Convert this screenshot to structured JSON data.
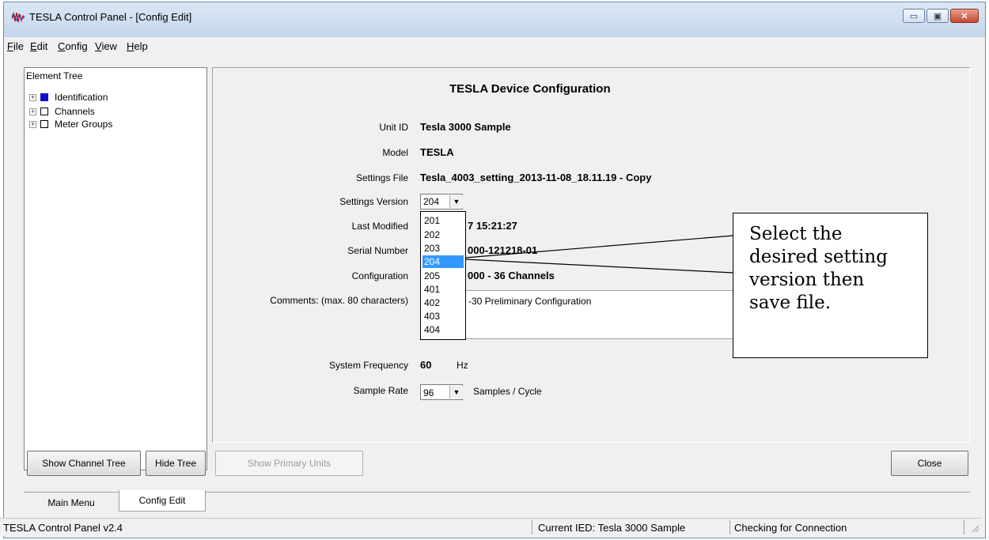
{
  "window": {
    "title": "TESLA Control Panel - [Config Edit]",
    "app_icon": "tesla-waveform-icon",
    "controls": {
      "minimize": "▭",
      "maximize": "▣",
      "close": "✕"
    }
  },
  "menu": [
    "File",
    "Edit",
    "Config",
    "View",
    "Help"
  ],
  "tree": {
    "header": "Element Tree",
    "items": [
      {
        "label": "Identification",
        "checked": true
      },
      {
        "label": "Channels",
        "checked": false
      },
      {
        "label": "Meter Groups",
        "checked": false
      }
    ]
  },
  "config": {
    "heading": "TESLA Device Configuration",
    "unit_id_label": "Unit ID",
    "unit_id": "Tesla 3000 Sample",
    "model_label": "Model",
    "model": "TESLA",
    "settings_file_label": "Settings File",
    "settings_file": "Tesla_4003_setting_2013-11-08_18.11.19 - Copy",
    "settings_version_label": "Settings Version",
    "settings_version": "204",
    "last_modified_label": "Last Modified",
    "last_modified_partial": "7 15:21:27",
    "serial_label": "Serial Number",
    "serial_partial": "000-121218-01",
    "configuration_label": "Configuration",
    "configuration_partial": "000 - 36 Channels",
    "comments_label": "Comments: (max. 80 characters)",
    "comments_partial": "-30 Preliminary Configuration",
    "freq_label": "System Frequency",
    "freq_value": "60",
    "freq_unit": "Hz",
    "sample_label": "Sample Rate",
    "sample_value": "96",
    "sample_unit": "Samples / Cycle"
  },
  "version_options": [
    "201",
    "202",
    "203",
    "204",
    "205",
    "401",
    "402",
    "403",
    "404"
  ],
  "selected_version": "204",
  "callout": {
    "lines": [
      "Select the",
      "desired setting",
      "version then",
      "save file."
    ]
  },
  "buttons": {
    "show_channel_tree": "Show Channel Tree",
    "hide_tree": "Hide Tree",
    "show_primary_units": "Show Primary Units",
    "close": "Close"
  },
  "tabs": [
    "Main Menu",
    "Config Edit"
  ],
  "status": {
    "version": "TESLA Control Panel v2.4",
    "current_ied": "Current IED:  Tesla 3000 Sample",
    "connection": "Checking for Connection"
  }
}
